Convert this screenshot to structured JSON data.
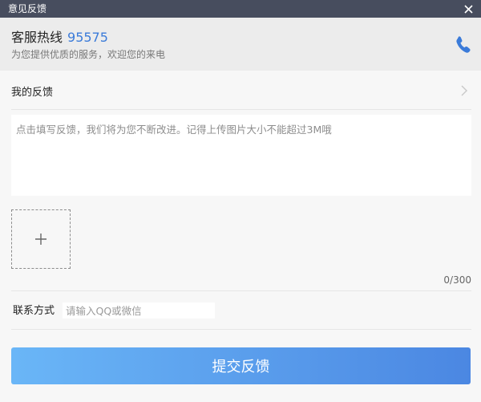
{
  "window": {
    "title": "意见反馈"
  },
  "hotline": {
    "label": "客服热线",
    "number": "95575",
    "subtitle": "为您提供优质的服务，欢迎您的来电",
    "icon": "phone-icon"
  },
  "my_feedback": {
    "label": "我的反馈",
    "icon": "chevron-right-icon"
  },
  "feedback": {
    "placeholder": "点击填写反馈，我们将为您不断改进。记得上传图片大小不能超过3M哦",
    "value": "",
    "counter": "0/300"
  },
  "upload": {
    "icon": "plus-icon"
  },
  "contact": {
    "label": "联系方式",
    "placeholder": "请输入QQ或微信",
    "value": ""
  },
  "submit": {
    "label": "提交反馈"
  },
  "colors": {
    "titlebar": "#474d5e",
    "accent": "#3b7bd9",
    "button_start": "#6ab6f7",
    "button_end": "#4b87e2"
  }
}
